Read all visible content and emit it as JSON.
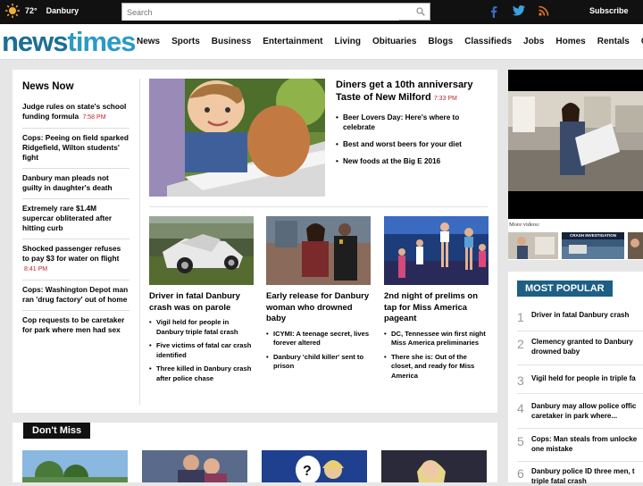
{
  "topbar": {
    "temperature": "72°",
    "location": "Danbury",
    "search_placeholder": "Search",
    "subscribe_label": "Subscribe"
  },
  "header": {
    "logo_part1": "news",
    "logo_part2": "times",
    "nav": [
      "News",
      "Sports",
      "Business",
      "Entertainment",
      "Living",
      "Obituaries",
      "Blogs",
      "Classifieds",
      "Jobs",
      "Homes",
      "Rentals",
      "C"
    ]
  },
  "news_now": {
    "title": "News Now",
    "items": [
      {
        "headline": "Judge rules on state's school funding formula",
        "time": "7:58 PM"
      },
      {
        "headline": "Cops: Peeing on field sparked Ridgefield, Wilton students' fight",
        "time": ""
      },
      {
        "headline": "Danbury man pleads not guilty in daughter's death",
        "time": ""
      },
      {
        "headline": "Extremely rare $1.4M supercar obliterated after hitting curb",
        "time": ""
      },
      {
        "headline": "Shocked passenger refuses to pay $3 for water on flight",
        "time": "8:41 PM"
      },
      {
        "headline": "Cops: Washington Depot man ran 'drug factory' out of home",
        "time": ""
      },
      {
        "headline": "Cop requests to be caretaker for park where men had sex",
        "time": ""
      }
    ]
  },
  "top_story": {
    "headline": "Diners get a 10th anniversary Taste of New Milford",
    "time": "7:33 PM",
    "bullets": [
      "Beer Lovers Day: Here's where to celebrate",
      "Best and worst beers for your diet",
      "New foods at the Big E 2016"
    ]
  },
  "stories": [
    {
      "headline": "Driver in fatal Danbury crash was on parole",
      "bullets": [
        "Vigil held for people in Danbury triple fatal crash",
        "Five victims of fatal car crash identified",
        "Three killed in Danbury crash after police chase"
      ]
    },
    {
      "headline": "Early release for Danbury woman who drowned baby",
      "bullets": [
        "ICYMI: A teenage secret, lives forever altered",
        "Danbury 'child killer' sent to prison"
      ]
    },
    {
      "headline": "2nd night of prelims on tap for Miss America pageant",
      "bullets": [
        "DC, Tennessee win first night Miss America preliminaries",
        "There she is: Out of the closet, and ready for Miss America"
      ]
    }
  ],
  "dont_miss": {
    "title": "Don't Miss"
  },
  "video": {
    "more_videos_label": "More videos:",
    "thumb_caption": "CRASH INVESTIGATION"
  },
  "popular": {
    "title": "MOST POPULAR",
    "items": [
      {
        "num": "1",
        "text": "Driver in fatal Danbury crash"
      },
      {
        "num": "2",
        "text": "Clemency granted to Danbury",
        "text2": "drowned baby"
      },
      {
        "num": "3",
        "text": "Vigil held for people in triple fa"
      },
      {
        "num": "4",
        "text": "Danbury may allow police offic",
        "text2": "caretaker in park where..."
      },
      {
        "num": "5",
        "text": "Cops: Man steals from unlocke",
        "text2": "one mistake"
      },
      {
        "num": "6",
        "text": "Danbury police ID three men, t",
        "text2": "triple fatal crash"
      }
    ]
  },
  "colors": {
    "topbar_bg": "#111111",
    "logo_blue": "#1d6e95",
    "timestamp_red": "#b8282d",
    "popular_blue": "#1e5f84"
  }
}
